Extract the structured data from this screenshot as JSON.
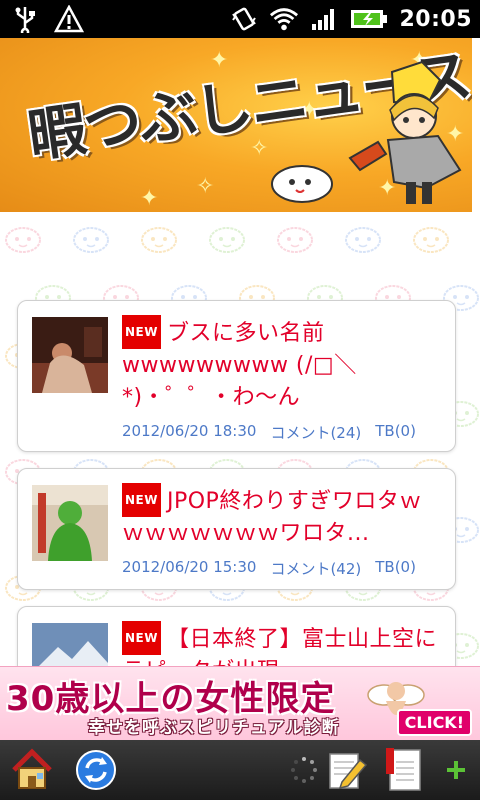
{
  "status_bar": {
    "time": "20:05",
    "icons": [
      "usb-icon",
      "warning-icon",
      "vibrate-icon",
      "wifi-icon",
      "signal-icon",
      "battery-charging-icon"
    ]
  },
  "banner": {
    "title": "暇つぶしニュース"
  },
  "articles": [
    {
      "badge": "NEW",
      "title": "ブスに多い名前wwwwwwwww (/□＼*)・゜゜・わ～ん",
      "date": "2012/06/20 18:30",
      "comments": "コメント(24)",
      "trackbacks": "TB(0)"
    },
    {
      "badge": "NEW",
      "title": "JPOP終わりすぎワロタｗｗｗｗｗｗｗｗワロタ...",
      "date": "2012/06/20 15:30",
      "comments": "コメント(42)",
      "trackbacks": "TB(0)"
    },
    {
      "badge": "NEW",
      "title": "【日本終了】富士山上空にラピュタが出現",
      "date": "",
      "comments": "",
      "trackbacks": ""
    }
  ],
  "ad": {
    "title": "30歳以上の女性限定",
    "subtitle": "幸せを呼ぶスピリチュアル診断",
    "cta": "CLICK!"
  },
  "toolbar": {
    "icons": [
      "home-icon",
      "refresh-icon",
      "loading-spinner-icon",
      "edit-note-icon",
      "bookmark-list-icon",
      "add-icon"
    ]
  },
  "colors": {
    "title_red": "#e2002a",
    "meta_blue": "#4d79c7",
    "badge_red": "#e40000",
    "banner_orange": "#f8a826"
  }
}
